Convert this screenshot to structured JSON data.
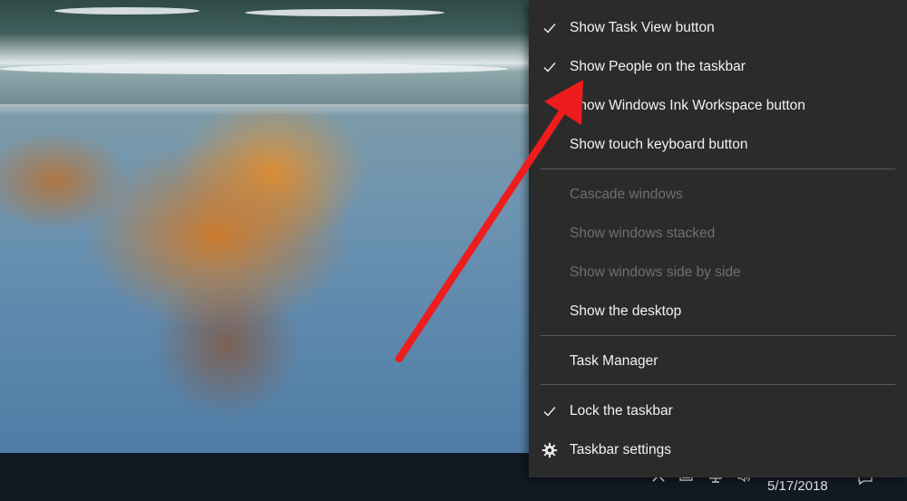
{
  "context_menu": {
    "items": [
      {
        "label": "Show Task View button",
        "checked": true,
        "enabled": true
      },
      {
        "label": "Show People on the taskbar",
        "checked": true,
        "enabled": true
      },
      {
        "label": "Show Windows Ink Workspace button",
        "checked": false,
        "enabled": true
      },
      {
        "label": "Show touch keyboard button",
        "checked": false,
        "enabled": true
      },
      {
        "label": "Cascade windows",
        "checked": false,
        "enabled": false
      },
      {
        "label": "Show windows stacked",
        "checked": false,
        "enabled": false
      },
      {
        "label": "Show windows side by side",
        "checked": false,
        "enabled": false
      },
      {
        "label": "Show the desktop",
        "checked": false,
        "enabled": true
      },
      {
        "label": "Task Manager",
        "checked": false,
        "enabled": true
      },
      {
        "label": "Lock the taskbar",
        "checked": true,
        "enabled": true
      },
      {
        "label": "Taskbar settings",
        "icon": "gear-icon",
        "enabled": true
      }
    ]
  },
  "taskbar": {
    "date": "5/17/2018",
    "tray_icons": [
      "chevron-up-icon",
      "battery-icon",
      "network-icon",
      "volume-icon",
      "notification-icon"
    ]
  },
  "annotation": {
    "arrow_color": "#ee1c1c",
    "points_to": "Show People on the taskbar"
  },
  "colors": {
    "menu_background": "#2b2b2b",
    "menu_text": "#f2f2f2",
    "menu_disabled_text": "#6f6f6f",
    "taskbar_background": "#111923"
  }
}
